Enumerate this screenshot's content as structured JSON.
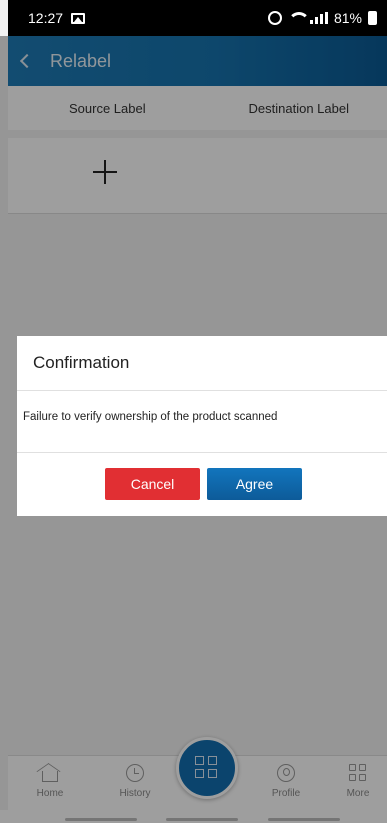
{
  "status_bar": {
    "time": "12:27",
    "battery": "81%",
    "icons": [
      "gallery-icon",
      "alarm-icon",
      "wifi-icon",
      "signal-icon",
      "battery-icon"
    ]
  },
  "app_bar": {
    "title": "Relabel",
    "back_icon": "chevron-left-icon",
    "colors": {
      "from": "#1e7bb6",
      "to": "#0b5a94"
    }
  },
  "tabs": [
    {
      "label": "Source Label"
    },
    {
      "label": "Destination Label"
    }
  ],
  "content": {
    "add_icon": "plus-icon"
  },
  "dialog": {
    "title": "Confirmation",
    "message": "Failure to verify ownership of the product scanned",
    "cancel_label": "Cancel",
    "agree_label": "Agree",
    "colors": {
      "cancel": "#e12f33",
      "agree": "#1275bd"
    }
  },
  "bottom_nav": {
    "items": [
      {
        "label": "Home",
        "icon": "home-icon"
      },
      {
        "label": "History",
        "icon": "history-icon"
      },
      {
        "label": "Profile",
        "icon": "profile-icon"
      },
      {
        "label": "More",
        "icon": "grid-icon"
      }
    ],
    "scan_icon": "qr-scan-icon"
  }
}
